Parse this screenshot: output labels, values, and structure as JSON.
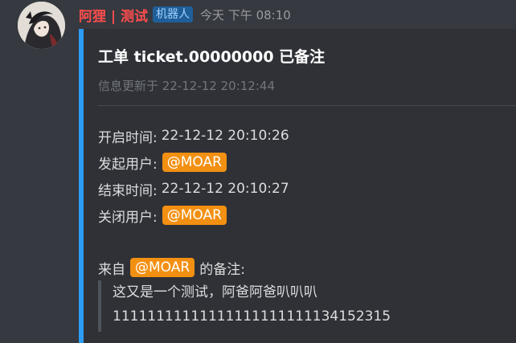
{
  "message": {
    "username": "阿狸 | 测试",
    "bot_tag": "机器人",
    "timestamp": "今天 下午 08:10"
  },
  "embed": {
    "accent_color": "#2d9cf4",
    "title": "工单 ticket.00000000 已备注",
    "subtitle": "信息更新于 22-12-12 20:12:44",
    "fields": {
      "open_time_label": "开启时间:",
      "open_time_value": "22-12-12 20:10:26",
      "initiator_label": "发起用户:",
      "initiator_mention": "@MOAR",
      "close_time_label": "结束时间:",
      "close_time_value": "22-12-12 20:10:27",
      "closer_label": "关闭用户:",
      "closer_mention": "@MOAR"
    },
    "note": {
      "prefix": "来自",
      "mention": "@MOAR",
      "suffix": "的备注:",
      "lines": [
        "这又是一个测试，阿爸阿爸叭叭叭",
        "11111111111111111111111134152315"
      ]
    }
  },
  "colors": {
    "background": "#36393f",
    "embed_background": "#2f3136",
    "mention": "#f39012",
    "username": "#ff4d4d"
  },
  "icons": {
    "avatar": "user-avatar-image"
  }
}
